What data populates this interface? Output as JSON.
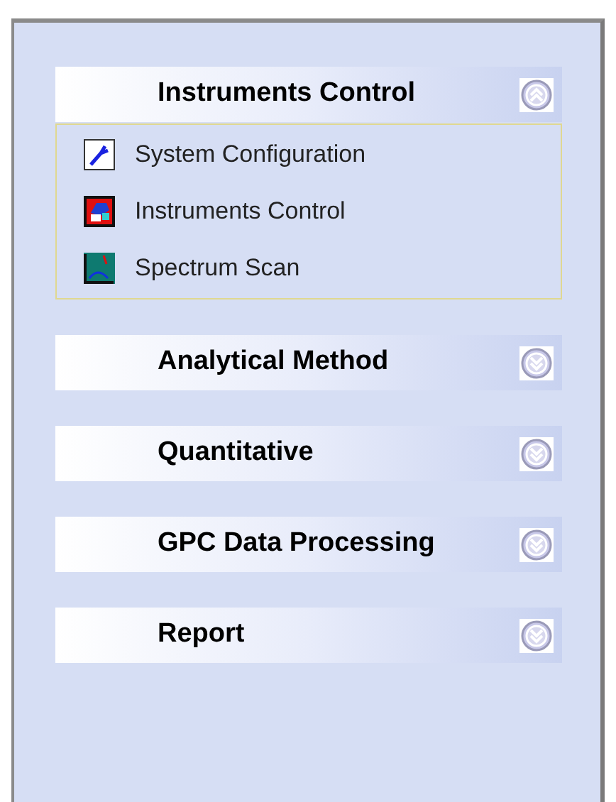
{
  "groups": [
    {
      "title": "Instruments Control",
      "expanded": true,
      "items": [
        {
          "label": "System Configuration",
          "kind": "wrench"
        },
        {
          "label": "Instruments Control",
          "kind": "instrument"
        },
        {
          "label": "Spectrum Scan",
          "kind": "spectrum"
        }
      ]
    },
    {
      "title": "Analytical Method",
      "expanded": false
    },
    {
      "title": "Quantitative",
      "expanded": false
    },
    {
      "title": "GPC Data Processing",
      "expanded": false
    },
    {
      "title": "Report",
      "expanded": false
    }
  ]
}
